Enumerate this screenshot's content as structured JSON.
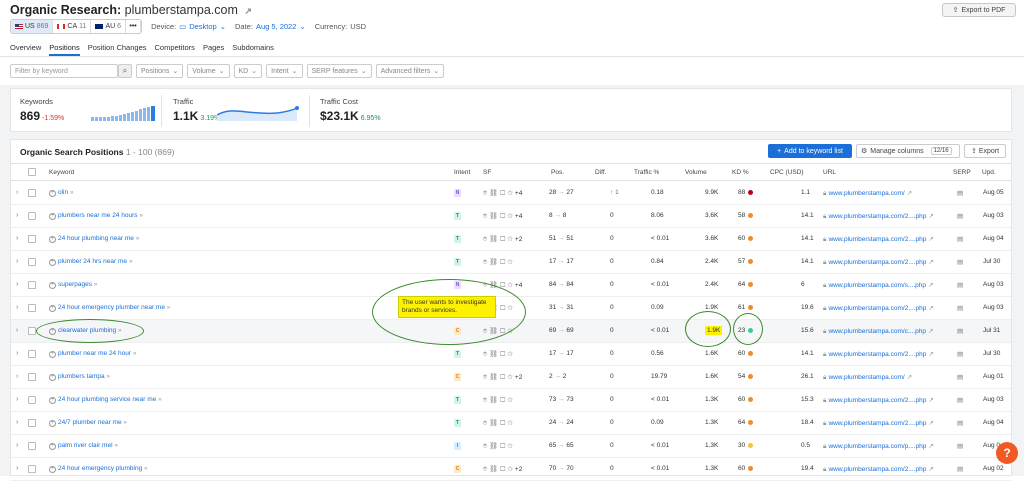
{
  "header": {
    "title_prefix": "Organic Research:",
    "domain": "plumberstampa.com",
    "export_pdf": "Export to PDF"
  },
  "databases": [
    {
      "code": "US",
      "count": "869",
      "active": true
    },
    {
      "code": "CA",
      "count": "11",
      "active": false
    },
    {
      "code": "AU",
      "count": "6",
      "active": false
    }
  ],
  "meta": {
    "device_label": "Device:",
    "device_value": "Desktop",
    "date_label": "Date:",
    "date_value": "Aug 5, 2022",
    "currency_label": "Currency:",
    "currency_value": "USD"
  },
  "tabs": [
    "Overview",
    "Positions",
    "Position Changes",
    "Competitors",
    "Pages",
    "Subdomains"
  ],
  "active_tab": "Positions",
  "filters": {
    "keyword_placeholder": "Filter by keyword",
    "buttons": [
      "Positions",
      "Volume",
      "KD",
      "Intent",
      "SERP features",
      "Advanced filters"
    ]
  },
  "metrics": {
    "keywords": {
      "label": "Keywords",
      "value": "869",
      "change": "-1.59%"
    },
    "traffic": {
      "label": "Traffic",
      "value": "1.1K",
      "change": "3.19%"
    },
    "traffic_cost": {
      "label": "Traffic Cost",
      "value": "$23.1K",
      "change": "6.95%"
    }
  },
  "table": {
    "title": "Organic Search Positions",
    "range": "1 - 100 (869)",
    "add_button": "Add to keyword list",
    "manage_button": "Manage columns",
    "manage_count": "12/16",
    "export_button": "Export",
    "columns": [
      "Keyword",
      "Intent",
      "SF",
      "Pos.",
      "Diff.",
      "Traffic %",
      "Volume",
      "KD %",
      "CPC (USD)",
      "URL",
      "SERP",
      "Upd."
    ],
    "rows": [
      {
        "keyword": "olin",
        "intent": "N",
        "sf": "+4",
        "pos_from": "28",
        "pos_to": "27",
        "diff": "1",
        "diff_up": true,
        "traffic": "0.18",
        "volume": "9.9K",
        "kd": "88",
        "kd_color": "#c0001a",
        "cpc": "1.1",
        "url": "www.plumberstampa.com/",
        "upd": "Aug 05"
      },
      {
        "keyword": "plumbers near me 24 hours",
        "intent": "T",
        "sf": "+4",
        "pos_from": "8",
        "pos_to": "8",
        "diff": "0",
        "diff_up": false,
        "traffic": "8.06",
        "volume": "3.6K",
        "kd": "58",
        "kd_color": "#f08a2c",
        "cpc": "14.1",
        "url": "www.plumberstampa.com/2....php",
        "upd": "Aug 03"
      },
      {
        "keyword": "24 hour plumbing near me",
        "intent": "T",
        "sf": "+2",
        "pos_from": "51",
        "pos_to": "51",
        "diff": "0",
        "diff_up": false,
        "traffic": "< 0.01",
        "volume": "3.6K",
        "kd": "60",
        "kd_color": "#f08a2c",
        "cpc": "14.1",
        "url": "www.plumberstampa.com/2....php",
        "upd": "Aug 04"
      },
      {
        "keyword": "plumber 24 hrs near me",
        "intent": "T",
        "sf": "",
        "pos_from": "17",
        "pos_to": "17",
        "diff": "0",
        "diff_up": false,
        "traffic": "0.84",
        "volume": "2.4K",
        "kd": "57",
        "kd_color": "#f08a2c",
        "cpc": "14.1",
        "url": "www.plumberstampa.com/2....php",
        "upd": "Jul 30"
      },
      {
        "keyword": "superpages",
        "intent": "N",
        "sf": "+4",
        "pos_from": "84",
        "pos_to": "84",
        "diff": "0",
        "diff_up": false,
        "traffic": "< 0.01",
        "volume": "2.4K",
        "kd": "64",
        "kd_color": "#f08a2c",
        "cpc": "6",
        "url": "www.plumberstampa.com/s....php",
        "upd": "Aug 03"
      },
      {
        "keyword": "24 hour emergency plumber near me",
        "intent": "T",
        "sf": "",
        "pos_from": "31",
        "pos_to": "31",
        "diff": "0",
        "diff_up": false,
        "traffic": "0.09",
        "volume": "1.9K",
        "kd": "61",
        "kd_color": "#f08a2c",
        "cpc": "19.6",
        "url": "www.plumberstampa.com/2....php",
        "upd": "Aug 03"
      },
      {
        "keyword": "clearwater plumbing",
        "intent": "C",
        "sf": "",
        "pos_from": "69",
        "pos_to": "69",
        "diff": "0",
        "diff_up": false,
        "traffic": "< 0.01",
        "volume": "1.9K",
        "kd": "23",
        "kd_color": "#3bc99a",
        "cpc": "15.6",
        "url": "www.plumberstampa.com/c....php",
        "upd": "Jul 31"
      },
      {
        "keyword": "plumber near me 24 hour",
        "intent": "T",
        "sf": "",
        "pos_from": "17",
        "pos_to": "17",
        "diff": "0",
        "diff_up": false,
        "traffic": "0.56",
        "volume": "1.6K",
        "kd": "60",
        "kd_color": "#f08a2c",
        "cpc": "14.1",
        "url": "www.plumberstampa.com/2....php",
        "upd": "Jul 30"
      },
      {
        "keyword": "plumbers tampa",
        "intent": "C",
        "sf": "+2",
        "pos_from": "2",
        "pos_to": "2",
        "diff": "0",
        "diff_up": false,
        "traffic": "19.79",
        "volume": "1.6K",
        "kd": "54",
        "kd_color": "#f08a2c",
        "cpc": "26.1",
        "url": "www.plumberstampa.com/",
        "upd": "Aug 01"
      },
      {
        "keyword": "24 hour plumbing service near me",
        "intent": "T",
        "sf": "",
        "pos_from": "73",
        "pos_to": "73",
        "diff": "0",
        "diff_up": false,
        "traffic": "< 0.01",
        "volume": "1.3K",
        "kd": "60",
        "kd_color": "#f08a2c",
        "cpc": "15.3",
        "url": "www.plumberstampa.com/2....php",
        "upd": "Aug 03"
      },
      {
        "keyword": "24/7 plumber near me",
        "intent": "T",
        "sf": "",
        "pos_from": "24",
        "pos_to": "24",
        "diff": "0",
        "diff_up": false,
        "traffic": "0.09",
        "volume": "1.3K",
        "kd": "64",
        "kd_color": "#f08a2c",
        "cpc": "18.4",
        "url": "www.plumberstampa.com/2....php",
        "upd": "Aug 04"
      },
      {
        "keyword": "palm river clair mel",
        "intent": "I",
        "sf": "",
        "pos_from": "65",
        "pos_to": "65",
        "diff": "0",
        "diff_up": false,
        "traffic": "< 0.01",
        "volume": "1.3K",
        "kd": "30",
        "kd_color": "#f3c33a",
        "cpc": "0.5",
        "url": "www.plumberstampa.com/p....php",
        "upd": "Aug 0"
      },
      {
        "keyword": "24 hour emergency plumbing",
        "intent": "C",
        "sf": "+2",
        "pos_from": "70",
        "pos_to": "70",
        "diff": "0",
        "diff_up": false,
        "traffic": "< 0.01",
        "volume": "1.3K",
        "kd": "60",
        "kd_color": "#f08a2c",
        "cpc": "19.4",
        "url": "www.plumberstampa.com/2....php",
        "upd": "Aug 02"
      }
    ]
  },
  "annotation": {
    "tooltip": "The user wants to investigate brands or services."
  },
  "help": "?"
}
